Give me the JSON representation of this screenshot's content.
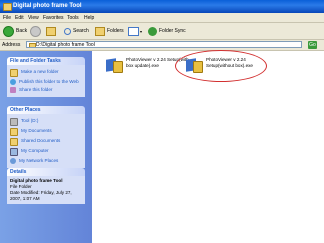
{
  "window": {
    "title": "Digital photo frame Tool"
  },
  "menu": [
    "File",
    "Edit",
    "View",
    "Favorites",
    "Tools",
    "Help"
  ],
  "toolbar": {
    "back_label": "Back",
    "search_label": "Search",
    "folders_label": "Folders",
    "foldersync_label": "Folder Sync"
  },
  "address": {
    "label": "Address",
    "value": "D:\\Digital photo frame Tool",
    "go": "Go"
  },
  "tasks": {
    "header": "File and Folder Tasks",
    "items": [
      "Make a new folder",
      "Publish this folder to the Web",
      "Share this folder"
    ]
  },
  "places": {
    "header": "Other Places",
    "items": [
      "Tool (D:)",
      "My Documents",
      "Shared Documents",
      "My Computer",
      "My Network Places"
    ]
  },
  "details": {
    "header": "Details",
    "name": "Digital photo frame Tool",
    "type": "File Folder",
    "modified": "Date Modified: Friday, July 27, 2007, 1:07 AM"
  },
  "files": [
    {
      "name": "PhotoViewer v 2.24 Setup(with box update).exe"
    },
    {
      "name": "PhotoViewer v 2.24 Setup(without box).exe"
    }
  ],
  "colors": {
    "accent": "#215dc6",
    "titlebar": "#0a5fd8",
    "highlight_ring": "#d23030"
  }
}
